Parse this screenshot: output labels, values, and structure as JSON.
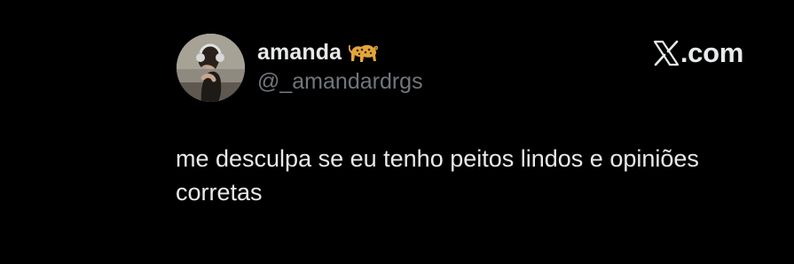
{
  "tweet": {
    "author": {
      "display_name": "amanda",
      "emoji_icon": "leopard-emoji",
      "handle": "@_amandardrgs",
      "avatar_icon": "profile-photo"
    },
    "brand": {
      "logo_icon": "x-logo-icon",
      "suffix": ".com"
    },
    "text": "me desculpa se eu tenho peitos lindos e opiniões corretas"
  },
  "colors": {
    "background": "#000000",
    "primary_text": "#e7e9ea",
    "secondary_text": "#71767b"
  }
}
